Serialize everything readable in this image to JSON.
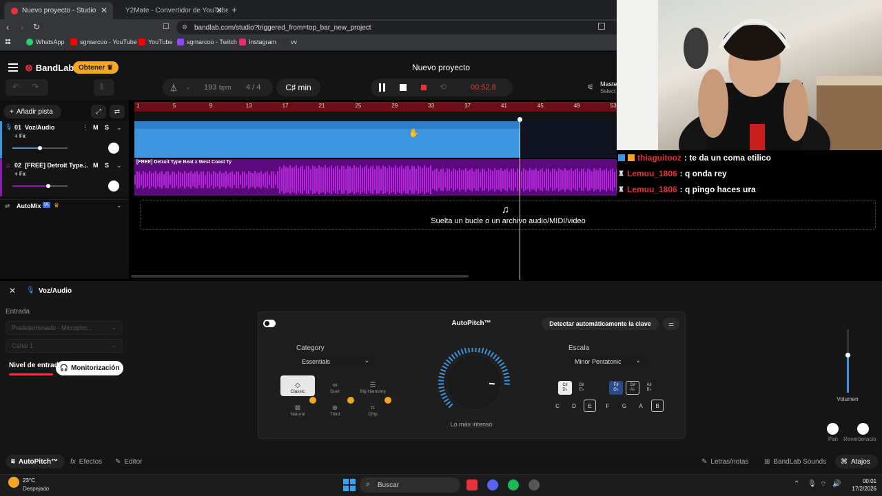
{
  "browser": {
    "tabs": [
      {
        "title": "Nuevo proyecto - Studio",
        "active": true
      },
      {
        "title": "Y2Mate - Convertidor de YouTube a",
        "active": false
      }
    ],
    "url": "bandlab.com/studio?triggered_from=top_bar_new_project",
    "bookmarks": [
      {
        "label": "WhatsApp",
        "color": "#25d366"
      },
      {
        "label": "sgmarcoo - YouTube",
        "color": "#ff0000"
      },
      {
        "label": "YouTube",
        "color": "#ff0000"
      },
      {
        "label": "sgmarcoo - Twitch",
        "color": "#9146ff"
      },
      {
        "label": "Instagram",
        "color": "#e1306c"
      },
      {
        "label": "vv",
        "color": "#333333"
      }
    ]
  },
  "app": {
    "brand": "BandLab",
    "get_button": "Obtener",
    "project_title": "Nuevo proyecto",
    "bpm_value": "193",
    "bpm_unit": "bpm",
    "time_sig": "4 / 4",
    "key": "C♯ min",
    "time_display": "00:52.8",
    "master_label": "Maste",
    "master_sub": "Select",
    "add_track": "Añadir pista",
    "drop_hint": "Suelta un bucle o un archivo audio/MIDI/video",
    "accent_color": "#e6343a"
  },
  "ruler": {
    "marks": [
      "1",
      "5",
      "9",
      "13",
      "17",
      "21",
      "25",
      "29",
      "33",
      "37",
      "41",
      "45",
      "49",
      "53"
    ]
  },
  "tracks": [
    {
      "number": "01",
      "name": "Voz/Audio",
      "fx": "+ Fx",
      "mute": "M",
      "solo": "S",
      "volume_fraction": 0.5,
      "color": "#3d95e0"
    },
    {
      "number": "02",
      "name": "[FREE] Detroit Type...",
      "fx": "+ Fx",
      "mute": "M",
      "solo": "S",
      "volume_fraction": 0.65,
      "color": "#5a0a7a",
      "clip_title": "[FREE] Detroit Type Beat x West Coast Ty"
    }
  ],
  "automix": {
    "label": "AutoMix",
    "badge": "IA"
  },
  "chat": [
    {
      "user": "thiaguitooz",
      "message": ": te da un coma etilico",
      "user_color": "#e63131"
    },
    {
      "user": "Lemuu_1806",
      "message": ": q onda rey",
      "user_color": "#e63131"
    },
    {
      "user": "Lemuu_1806",
      "message": ": q pingo haces ura",
      "user_color": "#e63131"
    }
  ],
  "panel": {
    "track_name": "Voz/Audio",
    "input_section": "Entrada",
    "input_device": "Predeterminado - Micropho...",
    "channel": "Canal 1",
    "input_level": "Nivel de entrad",
    "monitoring": "Monitorización",
    "autopitch_title": "AutoPitch™",
    "detect_key": "Detectar automáticamente la clave",
    "category_label": "Category",
    "category_value": "Essentials",
    "styles": [
      {
        "label": "Classic",
        "selected": true,
        "premium": false
      },
      {
        "label": "Duet",
        "selected": false,
        "premium": false
      },
      {
        "label": "Big Harmony",
        "selected": false,
        "premium": false
      },
      {
        "label": "Natural",
        "selected": false,
        "premium": true
      },
      {
        "label": "Third",
        "selected": false,
        "premium": true
      },
      {
        "label": "Chip",
        "selected": false,
        "premium": true
      }
    ],
    "knob_label": "Lo más intenso",
    "knob_fraction": 0.85,
    "scale_label": "Escala",
    "scale_value": "Minor Pentatonic",
    "accidentals": [
      {
        "top": "C♯",
        "bottom": "D♭",
        "style": "white"
      },
      {
        "top": "D♯",
        "bottom": "E♭",
        "style": "none"
      },
      {
        "top": "F♯",
        "bottom": "G♭",
        "style": "blue"
      },
      {
        "top": "G♯",
        "bottom": "A♭",
        "style": "outline"
      },
      {
        "top": "A♯",
        "bottom": "B♭",
        "style": "none"
      }
    ],
    "naturals": [
      {
        "note": "C",
        "on": false
      },
      {
        "note": "D",
        "on": false
      },
      {
        "note": "E",
        "on": true
      },
      {
        "note": "F",
        "on": false
      },
      {
        "note": "G",
        "on": false
      },
      {
        "note": "A",
        "on": false
      },
      {
        "note": "B",
        "on": true
      }
    ],
    "volume_label": "Volumen",
    "volume_fraction": 0.6,
    "pan_label": "Pan",
    "reverb_label": "Reverberacio"
  },
  "footer": {
    "tabs": [
      "AutoPitch™",
      "Efectos",
      "Editor"
    ],
    "right": [
      "Letras/notas",
      "BandLab Sounds",
      "Atajos"
    ]
  },
  "taskbar": {
    "temperature": "23°C",
    "weather": "Despejado",
    "search": "Buscar",
    "time": "00:01",
    "date": "17/2/2026"
  }
}
